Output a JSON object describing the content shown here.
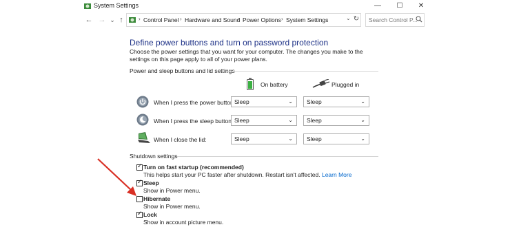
{
  "window": {
    "title": "System Settings",
    "minimize_glyph": "—",
    "maximize_glyph": "☐",
    "close_glyph": "✕"
  },
  "nav": {
    "back_glyph": "←",
    "forward_glyph": "→",
    "recent_glyph": "⌄",
    "up_glyph": "↑",
    "dropdown_glyph": "⌄",
    "refresh_glyph": "↻",
    "sep_glyph": "›",
    "breadcrumb": [
      "Control Panel",
      "Hardware and Sound",
      "Power Options",
      "System Settings"
    ],
    "search_placeholder": "Search Control P..."
  },
  "page": {
    "title": "Define power buttons and turn on password protection",
    "description": "Choose the power settings that you want for your computer. The changes you make to the settings on this page apply to all of your power plans."
  },
  "power_section": {
    "label": "Power and sleep buttons and lid settings",
    "columns": [
      "On battery",
      "Plugged in"
    ],
    "rows": [
      {
        "label": "When I press the power button:",
        "icon": "power-button-icon",
        "on_battery": "Sleep",
        "plugged_in": "Sleep"
      },
      {
        "label": "When I press the sleep button:",
        "icon": "sleep-button-icon",
        "on_battery": "Sleep",
        "plugged_in": "Sleep"
      },
      {
        "label": "When I close the lid:",
        "icon": "laptop-lid-icon",
        "on_battery": "Sleep",
        "plugged_in": "Sleep"
      }
    ]
  },
  "shutdown_section": {
    "label": "Shutdown settings",
    "options": [
      {
        "title": "Turn on fast startup (recommended)",
        "desc": "This helps start your PC faster after shutdown. Restart isn't affected.",
        "link": "Learn More",
        "checked": true
      },
      {
        "title": "Sleep",
        "desc": "Show in Power menu.",
        "checked": true
      },
      {
        "title": "Hibernate",
        "desc": "Show in Power menu.",
        "checked": false
      },
      {
        "title": "Lock",
        "desc": "Show in account picture menu.",
        "checked": true
      }
    ]
  },
  "colors": {
    "title_blue": "#1e3287",
    "link_blue": "#0066cc",
    "annotation_arrow": "#d93025"
  }
}
